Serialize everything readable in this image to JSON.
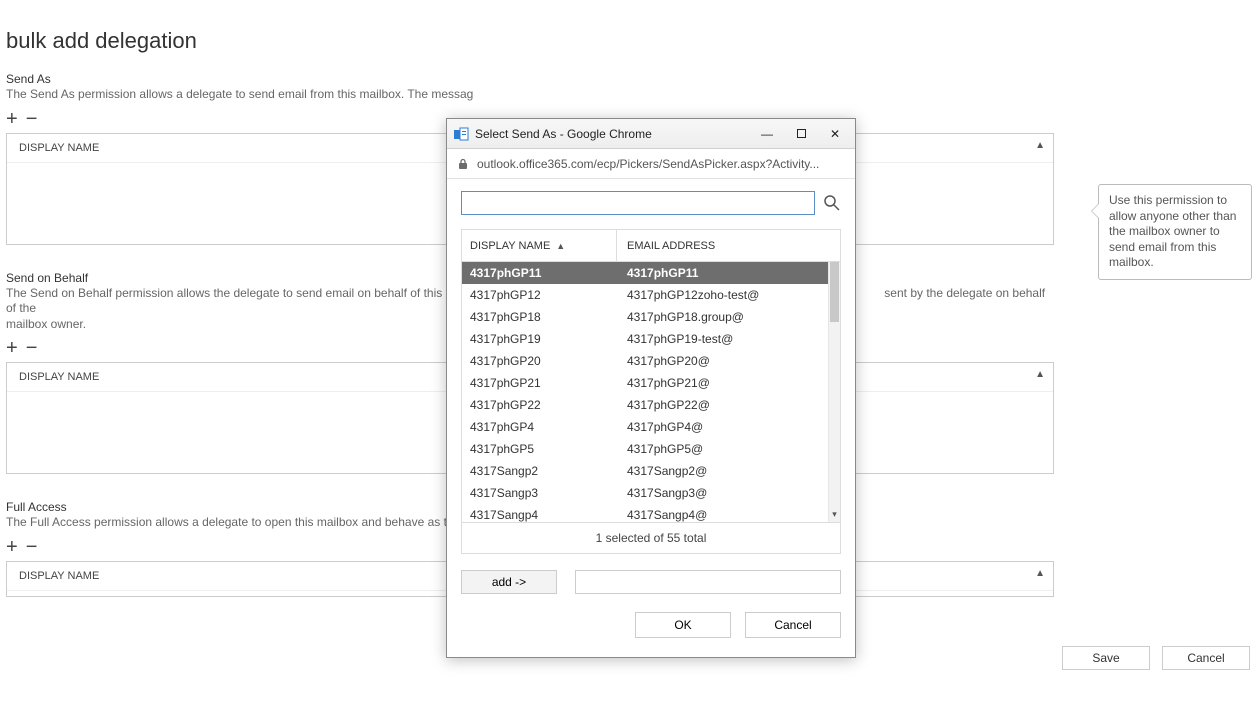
{
  "page_title": "bulk add delegation",
  "sections": {
    "send_as": {
      "heading": "Send As",
      "desc": "The Send As permission allows a delegate to send email from this mailbox. The messag",
      "column_header": "DISPLAY NAME"
    },
    "send_on_behalf": {
      "heading": "Send on Behalf",
      "desc_left": "The Send on Behalf permission allows the delegate to send email on behalf of this mail",
      "desc_right": "sent by the delegate on behalf of the",
      "desc_line2": "mailbox owner.",
      "column_header": "DISPLAY NAME"
    },
    "full_access": {
      "heading": "Full Access",
      "desc": "The Full Access permission allows a delegate to open this mailbox and behave as the m",
      "column_header": "DISPLAY NAME"
    }
  },
  "main_actions": {
    "save": "Save",
    "cancel": "Cancel"
  },
  "tooltip_text": "Use this permission to allow anyone other than the mailbox owner to send email from this mailbox.",
  "modal": {
    "window_title": "Select Send As - Google Chrome",
    "address": "outlook.office365.com/ecp/Pickers/SendAsPicker.aspx?Activity...",
    "search_value": "",
    "columns": {
      "name": "DISPLAY NAME",
      "email": "EMAIL ADDRESS"
    },
    "rows": [
      {
        "name": "4317phGP11",
        "email": "4317phGP11",
        "selected": true
      },
      {
        "name": "4317phGP12",
        "email": "4317phGP12zoho-test@"
      },
      {
        "name": "4317phGP18",
        "email": "4317phGP18.group@"
      },
      {
        "name": "4317phGP19",
        "email": "4317phGP19-test@"
      },
      {
        "name": "4317phGP20",
        "email": "4317phGP20@"
      },
      {
        "name": "4317phGP21",
        "email": "4317phGP21@"
      },
      {
        "name": "4317phGP22",
        "email": "4317phGP22@"
      },
      {
        "name": "4317phGP4",
        "email": "4317phGP4@"
      },
      {
        "name": "4317phGP5",
        "email": "4317phGP5@"
      },
      {
        "name": "4317Sangp2",
        "email": "4317Sangp2@"
      },
      {
        "name": "4317Sangp3",
        "email": "4317Sangp3@"
      },
      {
        "name": "4317Sangp4",
        "email": "4317Sangp4@"
      }
    ],
    "status": "1 selected of 55 total",
    "add_btn": "add ->",
    "add_target_value": "",
    "ok": "OK",
    "cancel": "Cancel"
  }
}
